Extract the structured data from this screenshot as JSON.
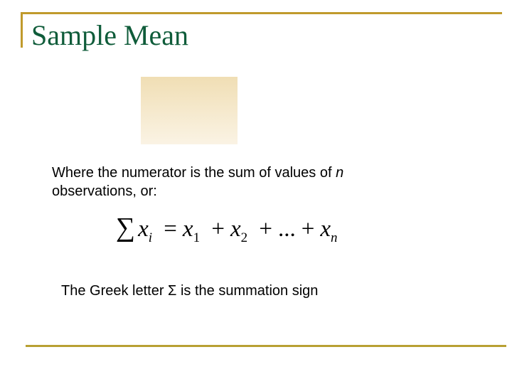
{
  "slide": {
    "title": "Sample Mean",
    "paragraph1": {
      "text_before": "Where the numerator is the sum of values of ",
      "italic_var": "n",
      "text_after": " observations, or:"
    },
    "formula": {
      "sigma": "∑",
      "lhs_var": "x",
      "lhs_sub": "i",
      "equals": "=",
      "term1_var": "x",
      "term1_sub": "1",
      "plus1": "+",
      "term2_var": "x",
      "term2_sub": "2",
      "plus2": "+",
      "ellipsis": "...",
      "plus3": "+",
      "termn_var": "x",
      "termn_sub": "n"
    },
    "paragraph2": "The Greek letter Σ is the summation sign",
    "colors": {
      "title": "#0f5c3a",
      "frame": "#c09a2c",
      "formula_placeholder_top": "#f0deb4",
      "formula_placeholder_bottom": "#faf3e4"
    }
  }
}
